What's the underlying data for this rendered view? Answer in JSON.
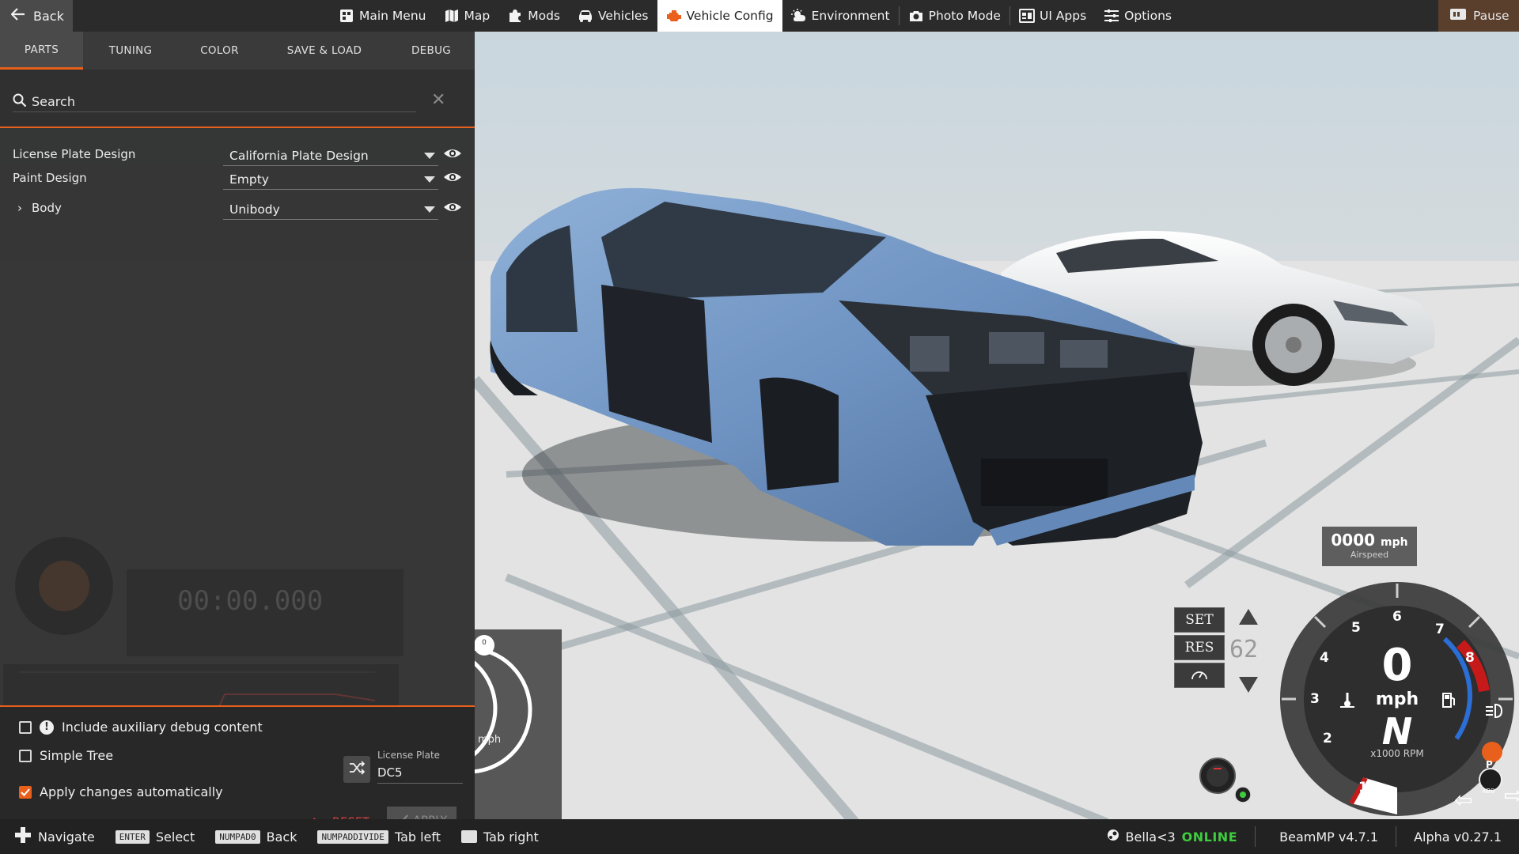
{
  "topbar": {
    "back": "Back",
    "nav": [
      {
        "label": "Main Menu",
        "icon": "main-menu-icon"
      },
      {
        "label": "Map",
        "icon": "map-icon"
      },
      {
        "label": "Mods",
        "icon": "puzzle-icon"
      },
      {
        "label": "Vehicles",
        "icon": "car-icon"
      },
      {
        "label": "Vehicle Config",
        "icon": "engine-icon",
        "active": true
      },
      {
        "label": "Environment",
        "icon": "weather-icon"
      },
      {
        "label": "Photo Mode",
        "icon": "camera-icon"
      },
      {
        "label": "UI Apps",
        "icon": "ui-apps-icon"
      },
      {
        "label": "Options",
        "icon": "sliders-icon"
      }
    ],
    "pause": "Pause"
  },
  "panel": {
    "tabs": [
      "PARTS",
      "TUNING",
      "COLOR",
      "SAVE & LOAD",
      "DEBUG"
    ],
    "search_placeholder": "Search",
    "parts": [
      {
        "label": "License Plate Design",
        "value": "California Plate Design"
      },
      {
        "label": "Paint Design",
        "value": "Empty"
      },
      {
        "label": "Body",
        "value": "Unibody"
      }
    ],
    "debug_checkbox": "Include auxiliary debug content",
    "simple_tree": "Simple Tree",
    "apply_auto": "Apply changes automatically",
    "license_plate_caption": "License Plate",
    "license_plate_value": "DC5",
    "reset": "RESET",
    "apply": "APPLY",
    "ghost_timer": "00:00.000"
  },
  "statusbar": {
    "hints": [
      {
        "key": "",
        "label": "Navigate",
        "icon": "dpad-icon"
      },
      {
        "key": "ENTER",
        "label": "Select"
      },
      {
        "key": "NUMPAD0",
        "label": "Back"
      },
      {
        "key": "NUMPADDIVIDE",
        "label": "Tab left"
      },
      {
        "key": "",
        "label": "Tab right"
      }
    ],
    "user": "Bella<3",
    "online": "ONLINE",
    "mp_version": "BeamMP v4.7.1",
    "game_version": "Alpha v0.27.1"
  },
  "hud": {
    "airspeed_value": "0000",
    "airspeed_unit": "mph",
    "airspeed_caption": "Airspeed",
    "set": "SET",
    "res": "RES",
    "cruise_speed": "62",
    "speed": "0",
    "speed_unit": "mph",
    "gear": "N",
    "rpm_caption": "x1000 RPM",
    "rpm_ticks": [
      "1",
      "2",
      "3",
      "4",
      "5",
      "6",
      "7",
      "8"
    ],
    "mini_speed_unit": "mph",
    "mini_zero": "0"
  },
  "colors": {
    "accent": "#e8601c",
    "online": "#3ecc3e",
    "reset": "#e24040"
  }
}
